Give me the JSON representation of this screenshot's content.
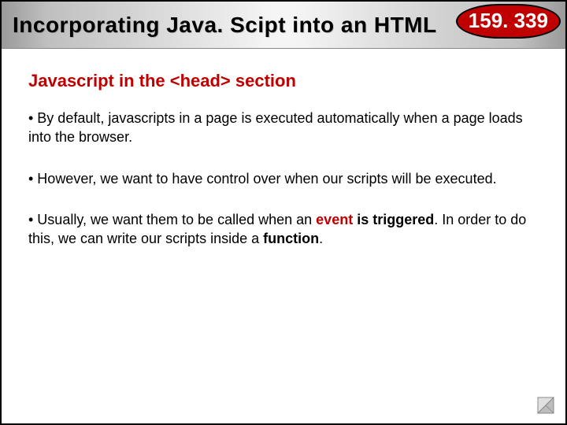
{
  "title": "Incorporating Java. Scipt into an HTML ",
  "badge": "159. 339",
  "subhead": "Javascript in the <head> section",
  "bullets": {
    "b1": "• By default, javascripts in a page is executed automatically when a page loads into the browser.",
    "b2": "• However, we want to have control over when our scripts will be executed.",
    "b3_pre": "• Usually, we want them to be called when an ",
    "b3_em": "event",
    "b3_mid": " is triggered",
    "b3_post1": ".  In order to do this, we can write our scripts inside a ",
    "b3_func": "function",
    "b3_post2": "."
  }
}
